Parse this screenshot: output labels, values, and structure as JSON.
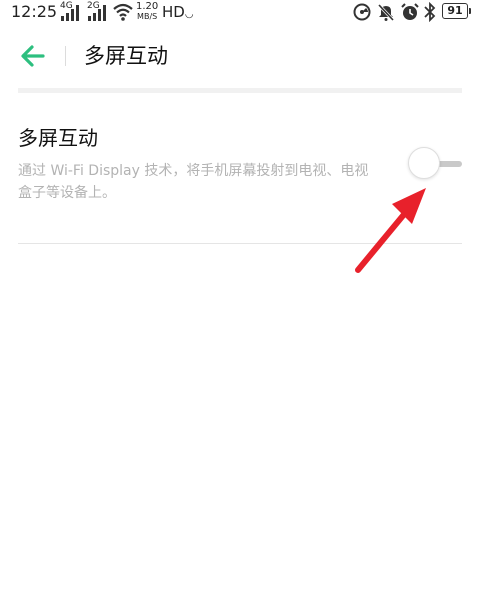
{
  "status_bar": {
    "time": "12:25",
    "sim1_label": "4G",
    "sim2_label": "2G",
    "net_speed_value": "1.20",
    "net_speed_unit": "MB/S",
    "hd_label": "HD",
    "battery_level": "91",
    "icons": [
      "signal-4g-icon",
      "signal-2g-icon",
      "wifi-icon",
      "hd-icon",
      "data-saver-icon",
      "mute-icon",
      "alarm-icon",
      "bluetooth-icon",
      "battery-icon"
    ]
  },
  "header": {
    "back_icon": "arrow-left-icon",
    "title": "多屏互动"
  },
  "setting": {
    "title": "多屏互动",
    "description": "通过 Wi-Fi Display 技术，将手机屏幕投射到电视、电视盒子等设备上。",
    "toggle_on": false
  },
  "colors": {
    "accent_green": "#2dbf7f",
    "annotation_red": "#e8212b",
    "desc_gray": "#b3b3b3",
    "track_gray": "#c9c9c9"
  }
}
